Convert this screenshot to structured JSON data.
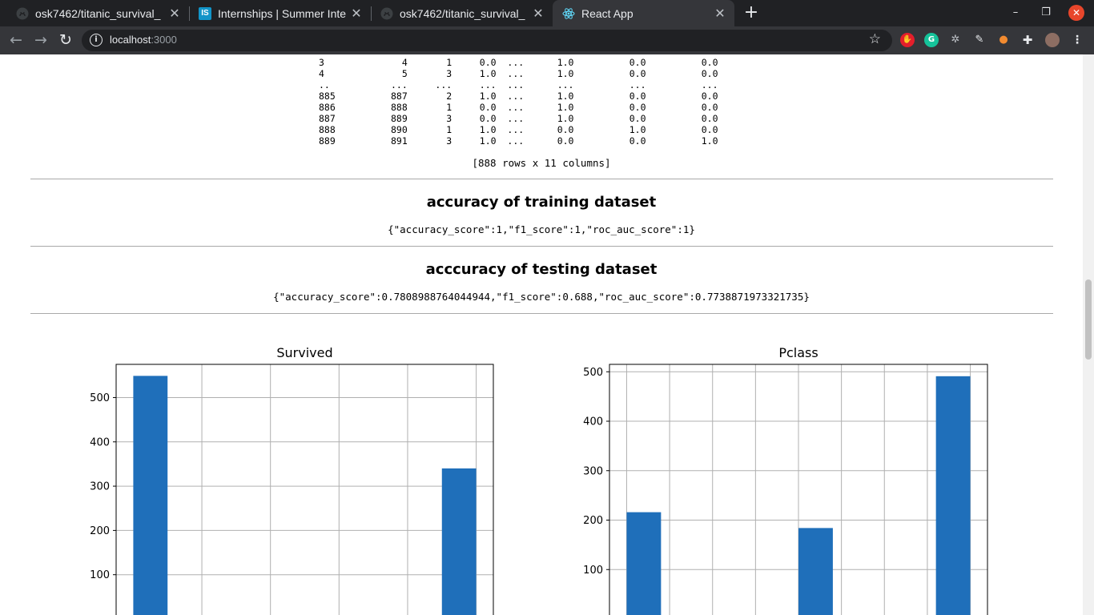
{
  "browser": {
    "tabs": [
      {
        "title": "osk7462/titanic_survival_",
        "favicon": "github-icon"
      },
      {
        "title": "Internships | Summer Inte",
        "favicon": "internshala-icon",
        "favicon_text": "IS"
      },
      {
        "title": "osk7462/titanic_survival_",
        "favicon": "github-icon"
      },
      {
        "title": "React App",
        "favicon": "react-icon"
      }
    ],
    "active_tab": 3,
    "url_host": "localhost",
    "url_port": ":3000"
  },
  "dataframe": {
    "rows": [
      [
        "3",
        "4",
        "1",
        "0.0",
        "...",
        "1.0",
        "0.0",
        "0.0"
      ],
      [
        "4",
        "5",
        "3",
        "1.0",
        "...",
        "1.0",
        "0.0",
        "0.0"
      ],
      [
        "..",
        "...",
        "...",
        "...",
        "...",
        "...",
        "...",
        "..."
      ],
      [
        "885",
        "887",
        "2",
        "1.0",
        "...",
        "1.0",
        "0.0",
        "0.0"
      ],
      [
        "886",
        "888",
        "1",
        "0.0",
        "...",
        "1.0",
        "0.0",
        "0.0"
      ],
      [
        "887",
        "889",
        "3",
        "0.0",
        "...",
        "1.0",
        "0.0",
        "0.0"
      ],
      [
        "888",
        "890",
        "1",
        "1.0",
        "...",
        "0.0",
        "1.0",
        "0.0"
      ],
      [
        "889",
        "891",
        "3",
        "1.0",
        "...",
        "0.0",
        "0.0",
        "1.0"
      ]
    ],
    "shape_text": "[888 rows x 11 columns]"
  },
  "training": {
    "heading": "accuracy of training dataset",
    "scores": "{\"accuracy_score\":1,\"f1_score\":1,\"roc_auc_score\":1}"
  },
  "testing": {
    "heading": "acccuracy of testing dataset",
    "scores": "{\"accuracy_score\":0.7808988764044944,\"f1_score\":0.688,\"roc_auc_score\":0.7738871973321735}"
  },
  "chart_data": [
    {
      "type": "bar",
      "title": "Survived",
      "bar_color": "#1f6fba",
      "grid": true,
      "xlim": [
        -0.05,
        1.05
      ],
      "ylim": [
        0,
        575
      ],
      "y_ticks": [
        100,
        200,
        300,
        400,
        500
      ],
      "x_grid": [
        0.2,
        0.4,
        0.6,
        0.8,
        1.0
      ],
      "bars": [
        {
          "x0": 0.0,
          "x1": 0.1,
          "value": 549
        },
        {
          "x0": 0.9,
          "x1": 1.0,
          "value": 340
        }
      ]
    },
    {
      "type": "bar",
      "title": "Pclass",
      "bar_color": "#1f6fba",
      "grid": true,
      "xlim": [
        0.9,
        3.1
      ],
      "ylim": [
        0,
        515
      ],
      "y_ticks": [
        100,
        200,
        300,
        400,
        500
      ],
      "x_grid": [
        1.0,
        1.25,
        1.5,
        1.75,
        2.0,
        2.25,
        2.5,
        2.75,
        3.0
      ],
      "bars": [
        {
          "x0": 1.0,
          "x1": 1.2,
          "value": 216
        },
        {
          "x0": 2.0,
          "x1": 2.2,
          "value": 184
        },
        {
          "x0": 2.8,
          "x1": 3.0,
          "value": 491
        }
      ]
    }
  ]
}
